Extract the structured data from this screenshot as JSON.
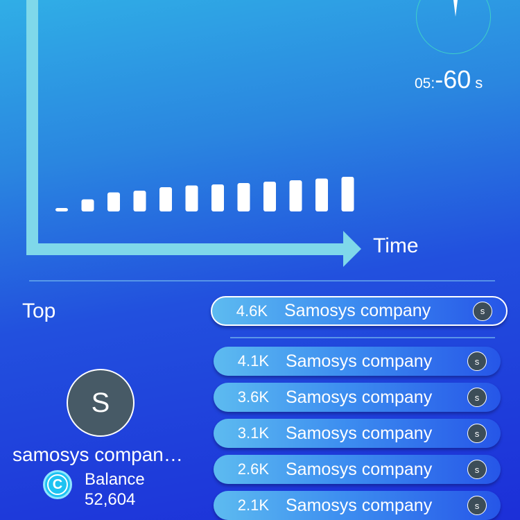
{
  "chart": {
    "x_axis_label": "Time",
    "bar_heights": [
      0.1,
      0.35,
      0.55,
      0.6,
      0.7,
      0.75,
      0.78,
      0.82,
      0.86,
      0.9,
      0.95,
      1.0
    ],
    "colors": {
      "axis": "#7fd8ea",
      "bar": "#ffffff"
    }
  },
  "timer": {
    "minutes": "05:",
    "seconds": "-60",
    "unit": "s"
  },
  "leaderboard": {
    "title": "Top",
    "top_entry": {
      "amount": "4.6K",
      "name": "Samosys company",
      "icon_letter": "s"
    },
    "entries": [
      {
        "amount": "4.1K",
        "name": "Samosys company",
        "icon_letter": "s"
      },
      {
        "amount": "3.6K",
        "name": "Samosys company",
        "icon_letter": "s"
      },
      {
        "amount": "3.1K",
        "name": "Samosys company",
        "icon_letter": "s"
      },
      {
        "amount": "2.6K",
        "name": "Samosys company",
        "icon_letter": "s"
      },
      {
        "amount": "2.1K",
        "name": "Samosys company",
        "icon_letter": "s"
      }
    ]
  },
  "user": {
    "avatar_letter": "S",
    "name": "samosys compan…",
    "balance_label": "Balance",
    "balance_value": "52,604",
    "coin_icon_glyph": "C"
  }
}
